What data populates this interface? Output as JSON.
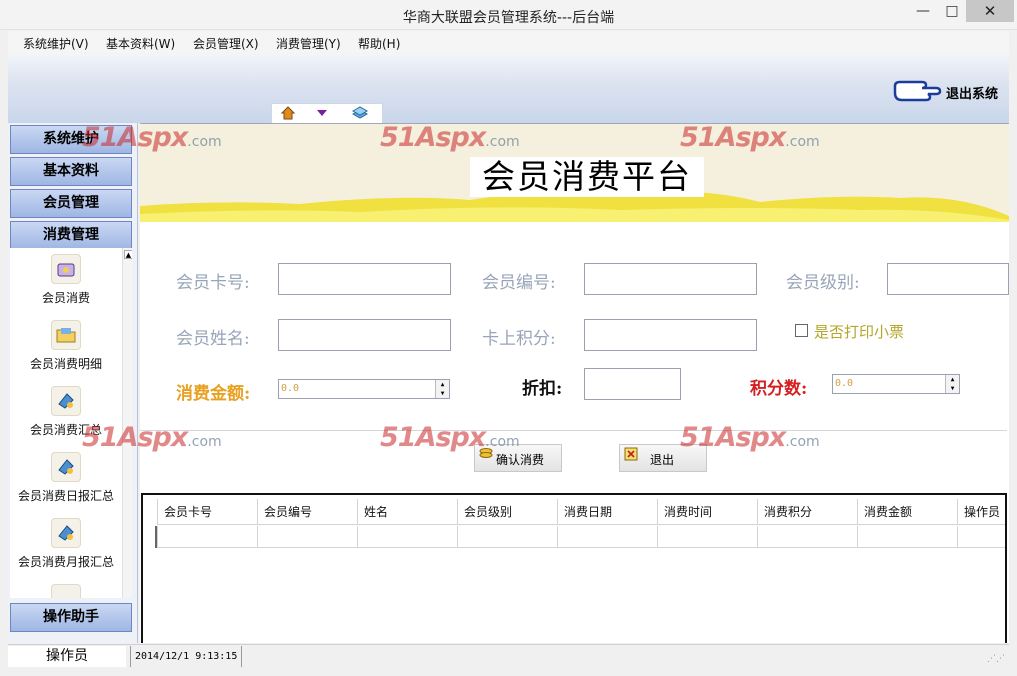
{
  "window": {
    "title": "华商大联盟会员管理系统---后台端",
    "minimize_glyph": "—",
    "maximize_glyph": "□",
    "close_glyph": "✕"
  },
  "menu": [
    "系统维护(V)",
    "基本资料(W)",
    "会员管理(X)",
    "消费管理(Y)",
    "帮助(H)"
  ],
  "toolbar": {
    "icons": [
      "home-icon",
      "down-arrow-icon",
      "stack-icon"
    ],
    "logout_label": "退出系统"
  },
  "nav": {
    "groups": [
      "系统维护",
      "基本资料",
      "会员管理",
      "消费管理"
    ],
    "items": [
      "会员消费",
      "会员消费明细",
      "会员消费汇总",
      "会员消费日报汇总",
      "会员消费月报汇总"
    ],
    "bottom_group": "操作助手"
  },
  "banner": {
    "title": "会员消费平台"
  },
  "form": {
    "card_no_label": "会员卡号:",
    "member_no_label": "会员编号:",
    "level_label": "会员级别:",
    "name_label": "会员姓名:",
    "card_points_label": "卡上积分:",
    "print_ticket_label": "是否打印小票",
    "amount_label": "消费金额:",
    "amount_value": "0.0",
    "discount_label": "折扣:",
    "points_label": "积分数:",
    "points_value": "0.0"
  },
  "actions": {
    "confirm_label": "确认消费",
    "exit_label": "退出"
  },
  "grid": {
    "columns": [
      "会员卡号",
      "会员编号",
      "姓名",
      "会员级别",
      "消费日期",
      "消费时间",
      "消费积分",
      "消费金额",
      "操作员"
    ]
  },
  "watermark": {
    "main": "51Aspx",
    "suffix": ".com"
  },
  "status": {
    "operator": "操作员",
    "datetime": "2014/12/1 9:13:15"
  },
  "colors": {
    "amount_label": "#e8a020",
    "points_label": "#d42020",
    "print_ticket": "#b4a628",
    "nav_button": "#a9bfe8",
    "banner_wave": "#f0e040"
  }
}
